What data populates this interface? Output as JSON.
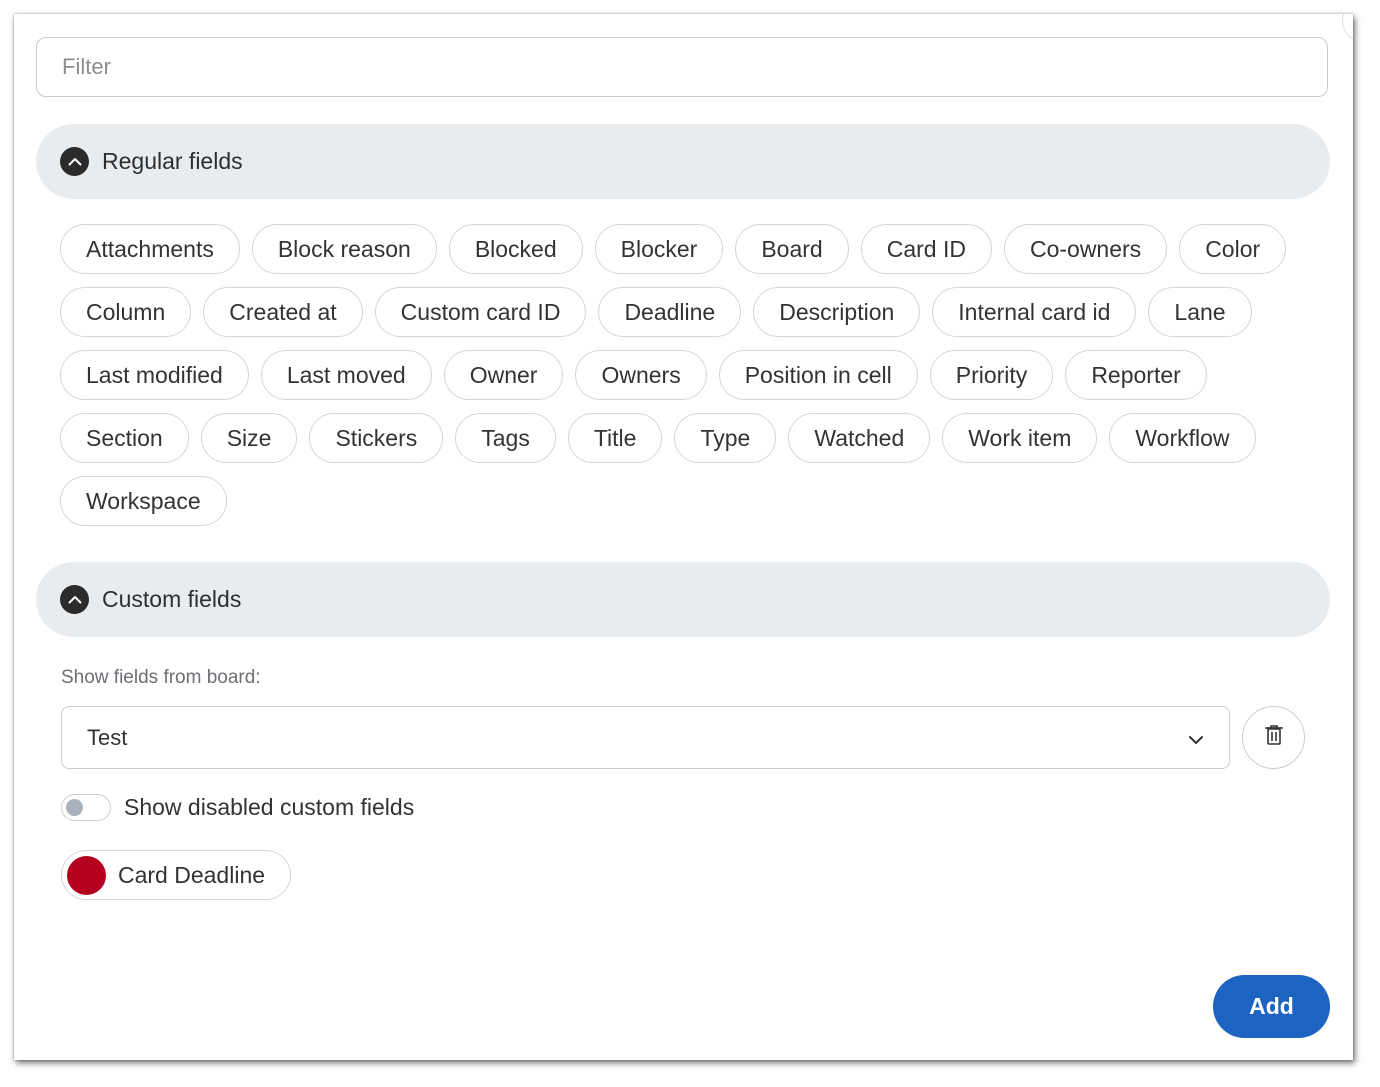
{
  "filter": {
    "placeholder": "Filter",
    "value": ""
  },
  "regular_fields": {
    "title": "Regular fields",
    "items": [
      "Attachments",
      "Block reason",
      "Blocked",
      "Blocker",
      "Board",
      "Card ID",
      "Co-owners",
      "Color",
      "Column",
      "Created at",
      "Custom card ID",
      "Deadline",
      "Description",
      "Internal card id",
      "Lane",
      "Last modified",
      "Last moved",
      "Owner",
      "Owners",
      "Position in cell",
      "Priority",
      "Reporter",
      "Section",
      "Size",
      "Stickers",
      "Tags",
      "Title",
      "Type",
      "Watched",
      "Work item",
      "Workflow",
      "Workspace"
    ]
  },
  "custom_fields": {
    "title": "Custom fields",
    "board_label": "Show fields from board:",
    "board_value": "Test",
    "toggle_label": "Show disabled custom fields",
    "toggle_on": false,
    "fields": [
      {
        "label": "Card Deadline",
        "color": "#b5001f"
      }
    ]
  },
  "actions": {
    "add_label": "Add"
  },
  "colors": {
    "accent": "#1d64c2",
    "section_bg": "#e9ecef",
    "field_dot": "#b5001f"
  },
  "icons": {
    "section_toggle": "chevron-up-icon",
    "dropdown": "chevron-down-icon",
    "remove": "trash-icon"
  }
}
